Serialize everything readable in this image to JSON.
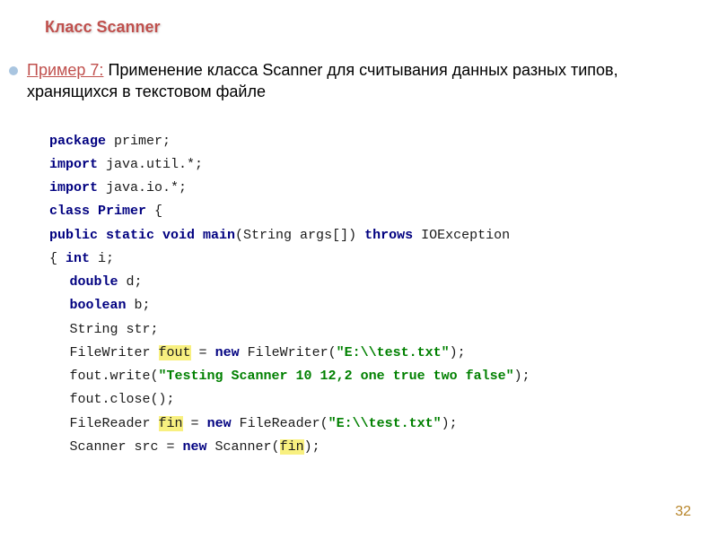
{
  "header": {
    "section_title": "Класс Scanner"
  },
  "content": {
    "example_label": "Пример 7:",
    "description_text": "Применение класса Scanner для считывания данных разных типов, хранящихся в текстовом файле"
  },
  "code": {
    "line1_kw": "package",
    "line1_rest": " primer;",
    "line2_kw": "import",
    "line2_rest": " java.util.*;",
    "line3_kw": "import",
    "line3_rest": " java.io.*;",
    "line4_kw": "class",
    "line4_mid": " ",
    "line4_name": "Primer",
    "line4_rest": " {",
    "line5_kw1": "public static void ",
    "line5_main": "main",
    "line5_mid": "(String args[]) ",
    "line5_kw2": "throws",
    "line5_rest": " IOException",
    "line6_pre": "{ ",
    "line6_kw": "int",
    "line6_rest": " i;",
    "line7_kw": "double",
    "line7_rest": " d;",
    "line8_kw": "boolean",
    "line8_rest": " b;",
    "line9": "String str;",
    "line10_pre": "FileWriter ",
    "line10_var": "fout",
    "line10_mid": " = ",
    "line10_kw": "new",
    "line10_mid2": " FileWriter(",
    "line10_str": "\"E:\\\\test.txt\"",
    "line10_rest": ");",
    "line11_pre": "fout.write(",
    "line11_str": "\"Testing Scanner 10 12,2 one true two false\"",
    "line11_rest": ");",
    "line12": "fout.close();",
    "line13_pre": "FileReader ",
    "line13_var": "fin",
    "line13_mid": " = ",
    "line13_kw": "new",
    "line13_mid2": " FileReader(",
    "line13_str": "\"E:\\\\test.txt\"",
    "line13_rest": ");",
    "line14_pre": "Scanner src = ",
    "line14_kw": "new",
    "line14_mid": " Scanner(",
    "line14_var": "fin",
    "line14_rest": ");"
  },
  "page_number": "32"
}
